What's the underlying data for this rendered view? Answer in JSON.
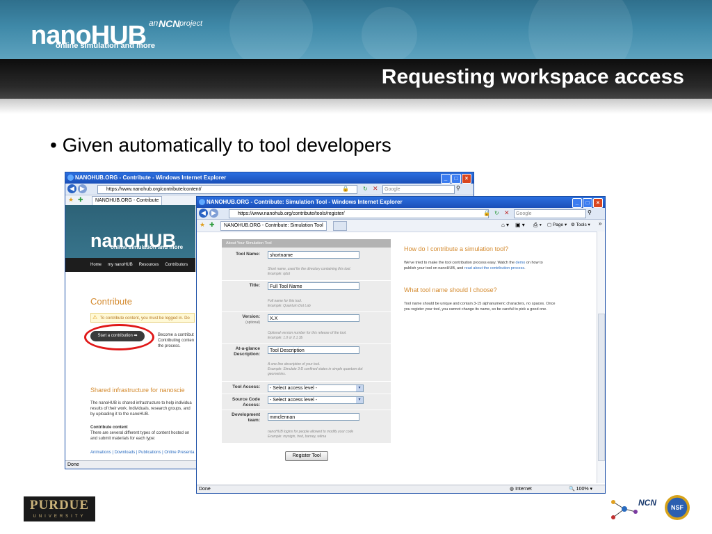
{
  "slide": {
    "logo": {
      "name": "nanoHUB",
      "tagline": "online simulation and more",
      "an": "an",
      "ncn": "NCN",
      "project": "project"
    },
    "title": "Requesting workspace access",
    "bullet": "• Given automatically to tool developers",
    "footer": {
      "purdue": "PURDUE",
      "university": "UNIVERSITY",
      "ncn": "NCN",
      "nsf": "NSF"
    }
  },
  "back_window": {
    "title": "NANOHUB.ORG - Contribute - Windows Internet Explorer",
    "url": "https://www.nanohub.org/contribute/content/",
    "search_placeholder": "Google",
    "tab": "NANOHUB.ORG - Contribute",
    "site_logo": "nanoHUB",
    "site_tagline": "online simulation and more",
    "nav": [
      "Home",
      "my nanoHUB",
      "Resources",
      "Contributors"
    ],
    "heading": "Contribute",
    "warning": "To contribute content, you must be logged in. Do",
    "start_button": "Start a contribution",
    "start_desc": [
      "Become a contribut",
      "Contributing conten",
      "the process."
    ],
    "shared_heading": "Shared infrastructure for nanoscie",
    "shared_text": [
      "The nanoHUB is shared infrastructure to help individua",
      "results of their work. Individuals, research groups, and",
      "by uploading it to the nanoHUB."
    ],
    "contribute_content_head": "Contribute content",
    "contribute_content_text": [
      "There are several different types of content hosted on",
      "and submit materials for each type:"
    ],
    "links": "Animations | Downloads | Publications | Online Presenta",
    "status": "Done"
  },
  "front_window": {
    "title": "NANOHUB.ORG - Contribute: Simulation Tool - Windows Internet Explorer",
    "url": "https://www.nanohub.org/contribute/tools/register/",
    "search_placeholder": "Google",
    "tab": "NANOHUB.ORG - Contribute: Simulation Tool",
    "cmd": {
      "page": "Page",
      "tools": "Tools"
    },
    "form": {
      "section": "About Your Simulation Tool",
      "tool_name_label": "Tool Name:",
      "tool_name_value": "shortname",
      "tool_name_help": [
        "Short name, used for the directory containing this tool.",
        "Example: qdot"
      ],
      "title_label": "Title:",
      "title_value": "Full Tool Name",
      "title_help": [
        "Full name for this tool.",
        "Example: Quantum Dot Lab"
      ],
      "version_label": "Version:",
      "version_sub": "(optional)",
      "version_value": "X.X",
      "version_help": [
        "Optional version number for this release of the tool.",
        "Example: 1.0 or 2.1.3b"
      ],
      "glance_label": [
        "At-a-glance",
        "Description:"
      ],
      "glance_value": "Tool Description",
      "glance_help": [
        "A one-line description of your tool.",
        "Example: Simulate 3-D confined states in simple quantum dot",
        "geometries."
      ],
      "access_label": "Tool Access:",
      "access_value": "- Select access level -",
      "source_label": [
        "Source Code",
        "Access:"
      ],
      "source_value": "- Select access level -",
      "team_label": [
        "Development",
        "team:"
      ],
      "team_value": "mmclennan",
      "team_help": [
        "nanoHUB logins for people allowed to modify your code",
        "Example: mynigin, fred, barney, wilma"
      ],
      "submit": "Register Tool"
    },
    "side": {
      "q1": "How do I contribute a simulation tool?",
      "a1_pre": "We've tried to make the tool contribution process easy. Watch the ",
      "a1_link1": "demo",
      "a1_mid": " on how to",
      "a1_line2_pre": "publish your tool on nanoHUB, and ",
      "a1_link2": "read about the contribution process",
      "a1_end": ".",
      "q2": "What tool name should I choose?",
      "a2": [
        "Tool name should be unique and contain 3-15 alphanumeric characters, no spaces. Once",
        "you register your tool, you cannot change its name, so be careful to pick a good one."
      ]
    },
    "status": {
      "left": "Done",
      "zone": "Internet",
      "zoom": "100%"
    }
  }
}
